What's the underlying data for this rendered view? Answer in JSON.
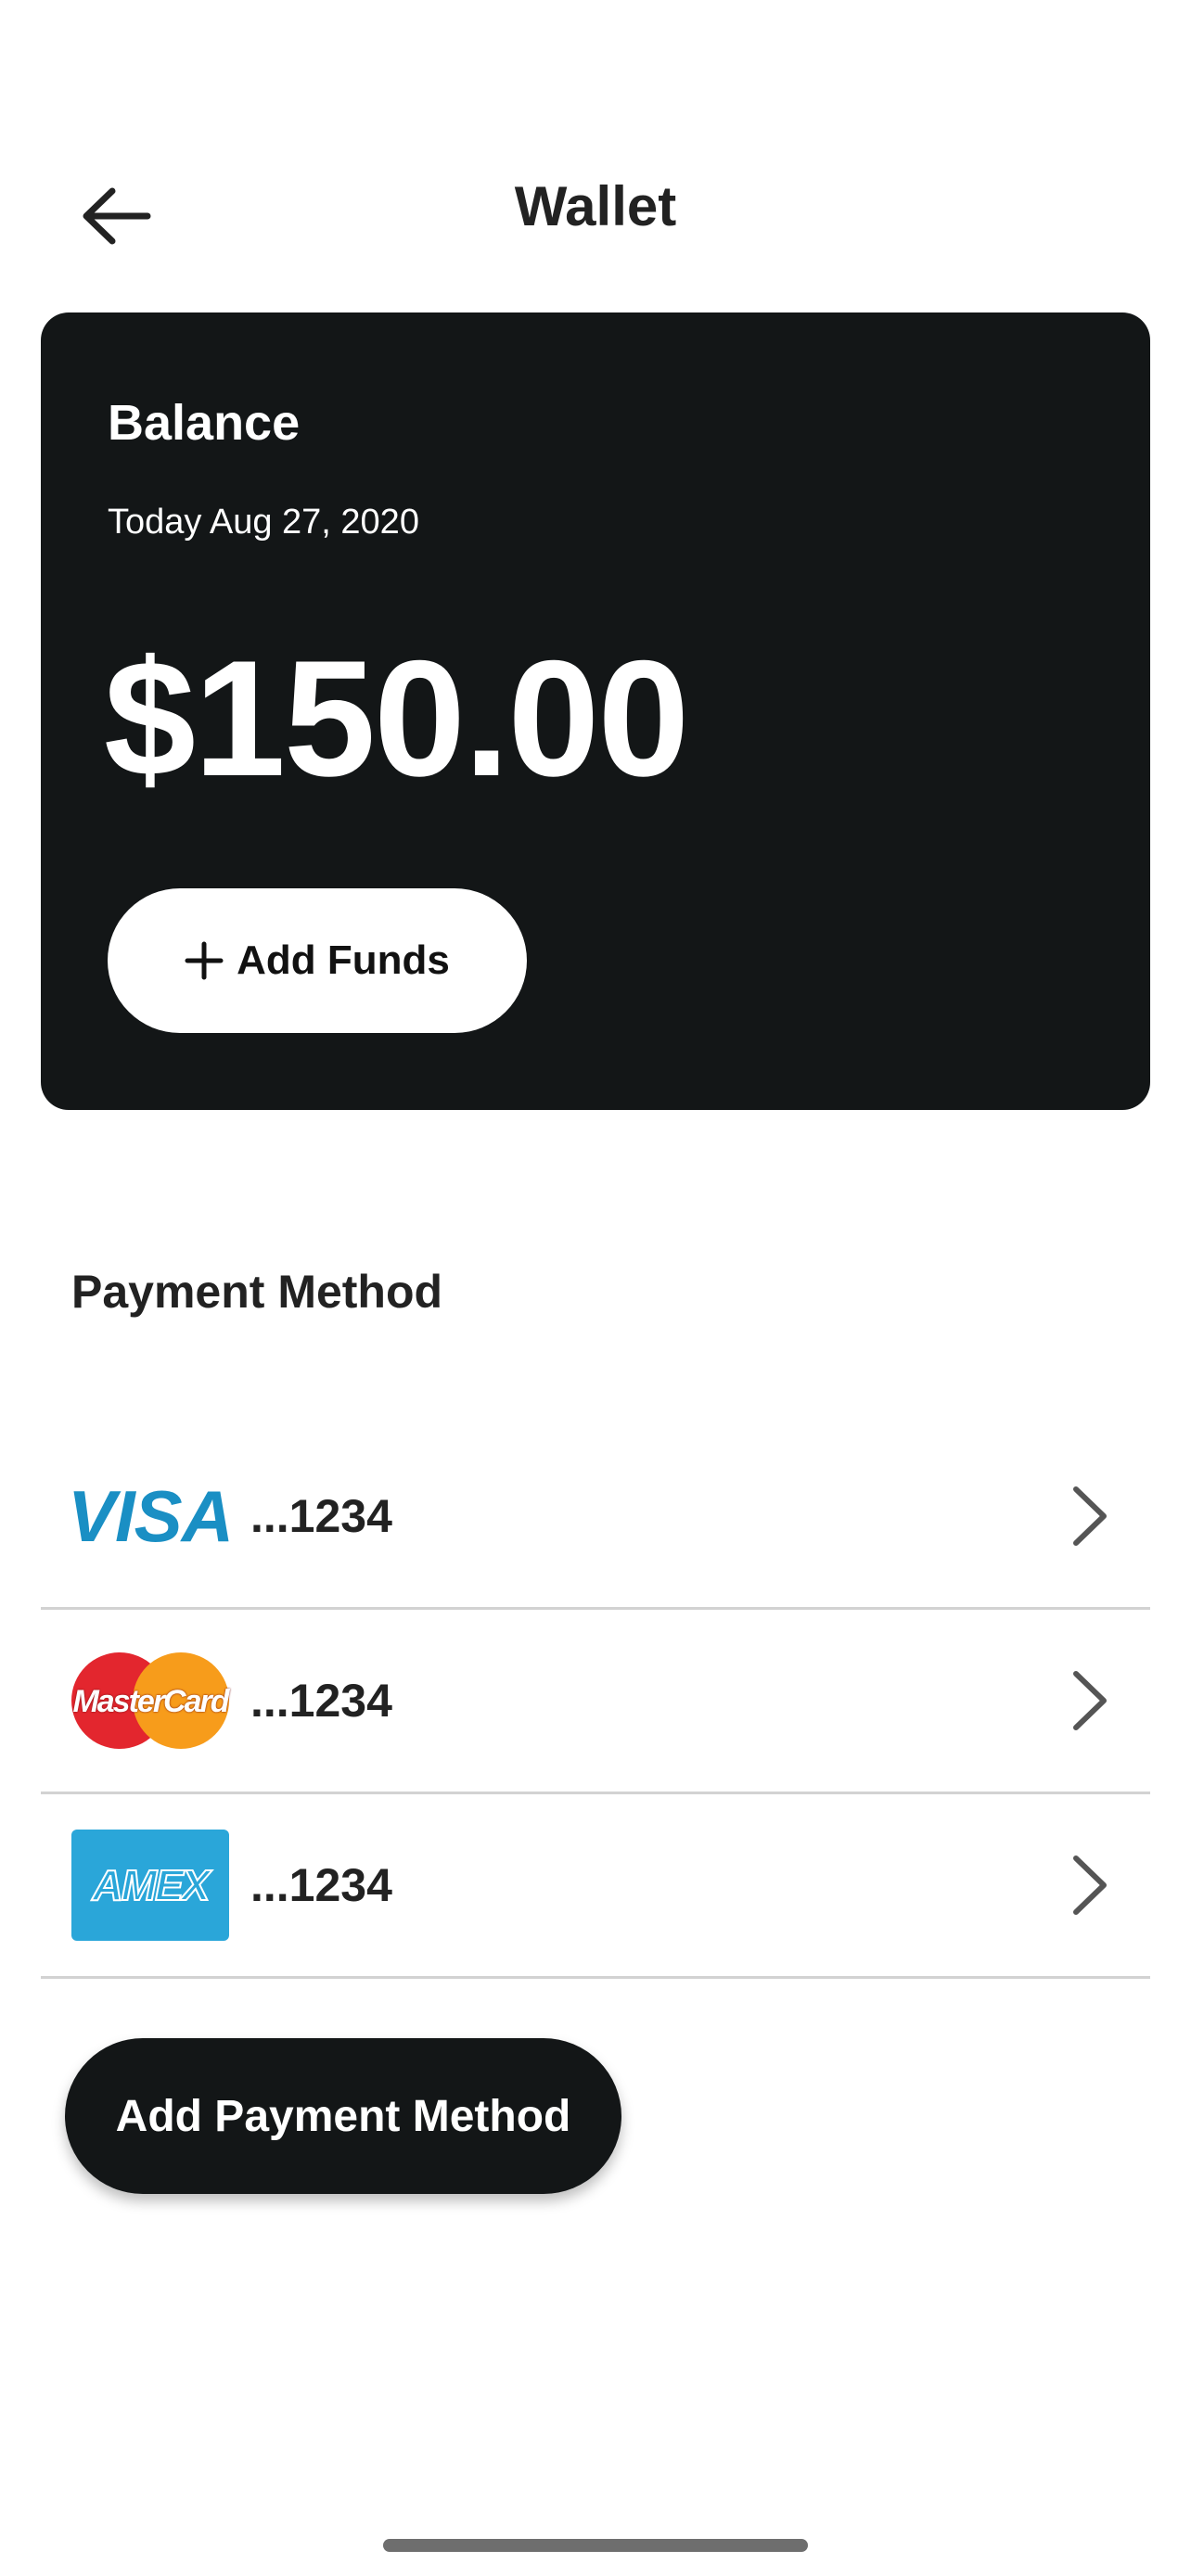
{
  "header": {
    "title": "Wallet",
    "back_icon": "arrow-left-icon"
  },
  "balance": {
    "label": "Balance",
    "date": "Today Aug 27, 2020",
    "amount": "$150.00",
    "add_funds_label": "Add Funds",
    "add_icon": "plus-icon"
  },
  "payment": {
    "section_title": "Payment Method",
    "methods": [
      {
        "brand": "VISA",
        "logo_icon": "visa-logo-icon",
        "number": "...1234"
      },
      {
        "brand": "MasterCard",
        "logo_icon": "mastercard-logo-icon",
        "number": "...1234"
      },
      {
        "brand": "AMEX",
        "logo_icon": "amex-logo-icon",
        "number": "...1234"
      }
    ],
    "add_button_label": "Add Payment Method"
  },
  "colors": {
    "card_bg": "#131617",
    "visa_blue": "#1a8fc4",
    "amex_blue": "#2aa6d9",
    "mc_red": "#e3262e",
    "mc_orange": "#f79c1b"
  }
}
